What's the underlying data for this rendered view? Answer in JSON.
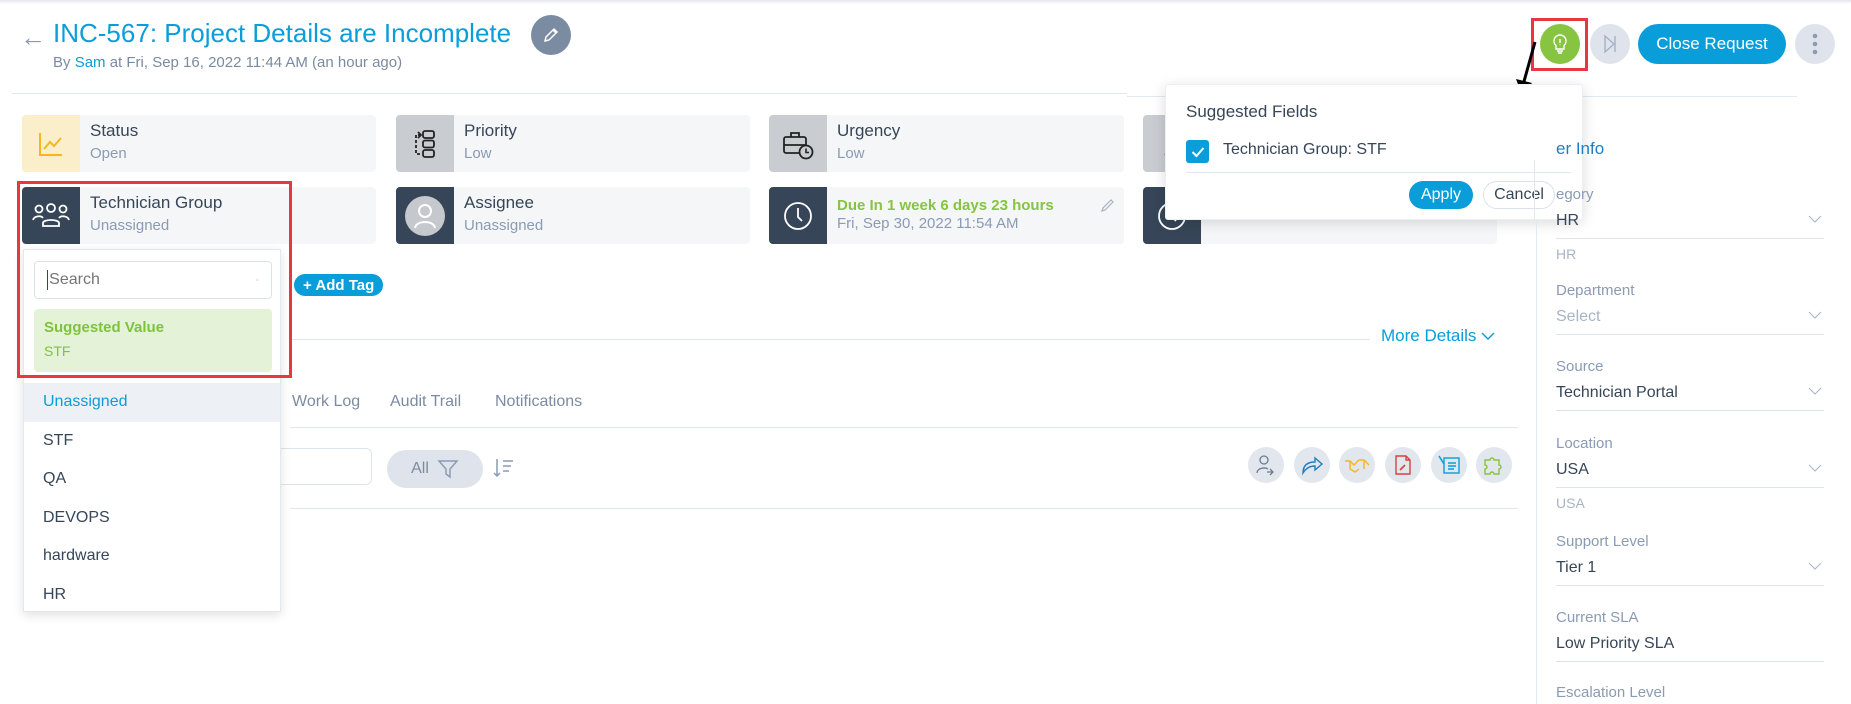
{
  "header": {
    "title": "INC-567: Project Details are Incomplete",
    "by_prefix": "By ",
    "author": "Sam",
    "meta": " at Fri, Sep 16, 2022 11:44 AM (an hour ago)",
    "close_request": "Close Request"
  },
  "cards": [
    {
      "label": "Status",
      "value": "Open",
      "icon": "chart-line-icon"
    },
    {
      "label": "Priority",
      "value": "Low",
      "icon": "priority-flow-icon"
    },
    {
      "label": "Urgency",
      "value": "Low",
      "icon": "briefcase-clock-icon"
    },
    {
      "label": "",
      "value": "",
      "icon": "impact-icon"
    },
    {
      "label": "Technician Group",
      "value": "Unassigned",
      "icon": "group-icon"
    },
    {
      "label": "Assignee",
      "value": "Unassigned",
      "icon": "user-avatar-icon"
    },
    {
      "label": "Due In 1 week 6 days 23 hours",
      "value": "Fri, Sep 30, 2022 11:54 AM",
      "icon": "clock-icon"
    },
    {
      "label": "",
      "value": "",
      "icon": "clock-icon"
    }
  ],
  "dropdown": {
    "search_placeholder": "Search",
    "suggested_heading": "Suggested Value",
    "suggested_value": "STF",
    "options": [
      "Unassigned",
      "STF",
      "QA",
      "DEVOPS",
      "hardware",
      "HR"
    ],
    "selected": "Unassigned"
  },
  "add_tag": "+ Add Tag",
  "more_details": "More Details",
  "tabs": [
    "Work Log",
    "Audit Trail",
    "Notifications"
  ],
  "toolbar": {
    "filter_label": "All"
  },
  "suggested_fields": {
    "heading": "Suggested Fields",
    "items": [
      {
        "label": "Technician Group: STF",
        "checked": true
      }
    ],
    "apply": "Apply",
    "cancel": "Cancel"
  },
  "right_panel": {
    "title": "Other Info",
    "title_visible": "er Info",
    "fields": [
      {
        "label": "Category",
        "label_visible": "egory",
        "value": "HR",
        "hint": "HR"
      },
      {
        "label": "Department",
        "value": "Select",
        "placeholder": true
      },
      {
        "label": "Source",
        "value": "Technician Portal"
      },
      {
        "label": "Location",
        "value": "USA",
        "hint": "USA"
      },
      {
        "label": "Support Level",
        "value": "Tier 1"
      },
      {
        "label": "Current SLA",
        "value": "Low Priority SLA"
      },
      {
        "label": "Escalation Level",
        "value": ""
      }
    ]
  },
  "colors": {
    "accent": "#099dd9",
    "success": "#86c441",
    "highlight_box": "#e8383d",
    "dark_icon_bg": "#364658"
  }
}
